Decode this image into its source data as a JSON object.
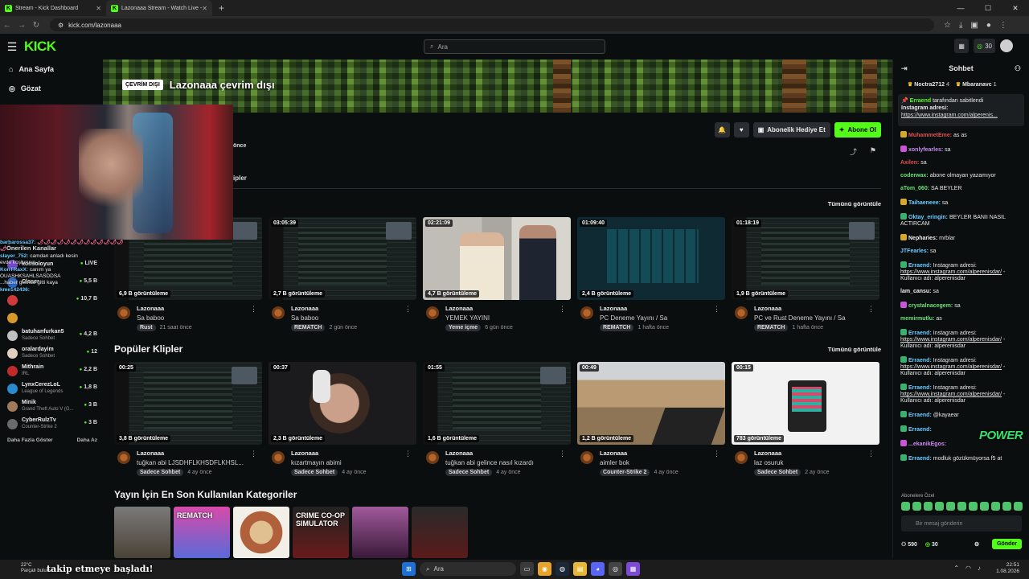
{
  "browser": {
    "tabs": [
      {
        "title": "Stream - Kick Dashboard",
        "active": false
      },
      {
        "title": "Lazonaaa Stream - Watch Live -",
        "active": true
      }
    ],
    "url": "kick.com/lazonaaa"
  },
  "topbar": {
    "logo": "KICK",
    "search_placeholder": "Ara",
    "points": "30"
  },
  "sidebar": {
    "nav": [
      {
        "label": "Ana Sayfa",
        "icon": "home-icon"
      },
      {
        "label": "Gözat",
        "icon": "compass-icon"
      }
    ],
    "suggested_title": "Önerilen Kanallar",
    "channels": [
      {
        "name": "konsoloyun",
        "category": "",
        "viewers": "LIVE",
        "color": "#7b4bd6"
      },
      {
        "name": "Closer",
        "category": "",
        "viewers": "5,5 B",
        "color": "#2d6ad0"
      },
      {
        "name": "",
        "category": "",
        "viewers": "10,7 B",
        "color": "#d03a3a"
      },
      {
        "name": "",
        "category": "",
        "viewers": "",
        "color": "#d79a2a"
      },
      {
        "name": "batuhanfurkan5",
        "category": "Sadece Sohbet",
        "viewers": "4,2 B",
        "color": "#c0c0c0"
      },
      {
        "name": "oralardayim",
        "category": "Sadece Sohbet",
        "viewers": "12",
        "color": "#e0d0c0"
      },
      {
        "name": "Mithrain",
        "category": "IRL",
        "viewers": "2,2 B",
        "color": "#c02a2a"
      },
      {
        "name": "LynxCerezLoL",
        "category": "League of Legends",
        "viewers": "1,8 B",
        "color": "#2a8ad0"
      },
      {
        "name": "Minik",
        "category": "Grand Theft Auto V (G...",
        "viewers": "3 B",
        "color": "#a07a5a"
      },
      {
        "name": "CyberRulzTv",
        "category": "Counter-Strike 2",
        "viewers": "3 B",
        "color": "#6a6a6a"
      }
    ],
    "show_more": "Daha Fazla Göster",
    "show_less": "Daha Az"
  },
  "overlay_chat": [
    {
      "user": "barbarossa37:",
      "text": "🌶🌶🌶🌶🌶🌶🌶🌶🌶🌶🌶🌶🌶🌶"
    },
    {
      "user": "slayer_752:",
      "text": "camdan anladı kesin"
    },
    {
      "user": "",
      "text": "evde koşturuyo"
    },
    {
      "user": "KonTRaxX:",
      "text": "canım ya"
    },
    {
      "user": "",
      "text": ""
    },
    {
      "user": "",
      "text": "OUASHKSAHLSASDDSA"
    },
    {
      "user": "",
      "text": "...haber gelince gitti kaya"
    },
    {
      "user": "kme142436:",
      "text": ""
    }
  ],
  "channel": {
    "offline_badge": "ÇEVRİM DIŞI",
    "offline_title": "Lazonaaa çevrim dışı",
    "gift_label": "Abonelik Hediye Et",
    "subscribe_label": "Abone Ol",
    "frag_top": "önce",
    "frag_clips": "ipler"
  },
  "sections": {
    "see_all": "Tümünü görüntüle",
    "popular_clips": "Popüler Klipler",
    "categories": "Yayın İçin En Son Kullanılan Kategoriler"
  },
  "videos": [
    {
      "duration": "",
      "views": "6,9 B görüntüleme",
      "channel": "Lazonaaa",
      "title": "Sa baboo",
      "tag": "Rust",
      "ago": "21 saat önce",
      "style": "dash"
    },
    {
      "duration": "03:05:39",
      "views": "2,7 B görüntüleme",
      "channel": "Lazonaaa",
      "title": "Sa baboo",
      "tag": "REMATCH",
      "ago": "2 gün önce",
      "style": "dash"
    },
    {
      "duration": "02:21:09",
      "views": "4,7 B görüntüleme",
      "channel": "Lazonaaa",
      "title": "YEMEK YAYINI",
      "tag": "Yeme içme",
      "ago": "6 gün önce",
      "style": "room"
    },
    {
      "duration": "01:09:40",
      "views": "2,4 B görüntüleme",
      "channel": "Lazonaaa",
      "title": "PC Deneme Yayını / Sa",
      "tag": "REMATCH",
      "ago": "1 hafta önce",
      "style": "stats"
    },
    {
      "duration": "01:18:19",
      "views": "1,9 B görüntüleme",
      "channel": "Lazonaaa",
      "title": "PC ve Rust Deneme Yayını / Sa",
      "tag": "REMATCH",
      "ago": "1 hafta önce",
      "style": "dash"
    }
  ],
  "clips": [
    {
      "duration": "00:25",
      "views": "3,8 B görüntüleme",
      "channel": "Lazonaaa",
      "title": "tuğkan abi LJSDHFLKHSDFLKHSL...",
      "tag": "Sadece Sohbet",
      "ago": "4 ay önce",
      "style": "dash"
    },
    {
      "duration": "00:37",
      "views": "2,3 B görüntüleme",
      "channel": "Lazonaaa",
      "title": "kızartmayın abimi",
      "tag": "Sadece Sohbet",
      "ago": "4 ay önce",
      "style": "face"
    },
    {
      "duration": "01:55",
      "views": "1,6 B görüntüleme",
      "channel": "Lazonaaa",
      "title": "tuğkan abi gelince nasıl kızardı",
      "tag": "Sadece Sohbet",
      "ago": "4 ay önce",
      "style": "dash"
    },
    {
      "duration": "00:49",
      "views": "1,2 B görüntüleme",
      "channel": "Lazonaaa",
      "title": "aimler bok",
      "tag": "Counter-Strike 2",
      "ago": "4 ay önce",
      "style": "cs"
    },
    {
      "duration": "00:15",
      "views": "783 görüntüleme",
      "channel": "Lazonaaa",
      "title": "laz osuruk",
      "tag": "Sadece Sohbet",
      "ago": "2 ay önce",
      "style": "white"
    }
  ],
  "categories": [
    {
      "label": "",
      "bg": "linear-gradient(180deg,#7a7a7a,#4a4236)"
    },
    {
      "label": "REMATCH",
      "bg": "linear-gradient(180deg,#d84aa8,#5a6ad8)"
    },
    {
      "label": "",
      "bg": "radial-gradient(circle,#e0c090 0 30%,#b0603a 31% 55%,#f2efe8 56%)"
    },
    {
      "label": "CRIME CO-OP SIMULATOR",
      "bg": "linear-gradient(180deg,#222,#6a1a1a)"
    },
    {
      "label": "",
      "bg": "linear-gradient(180deg,#a05a9a,#3a1a3a)"
    },
    {
      "label": "",
      "bg": "linear-gradient(180deg,#2a2a2a,#5a1a1a)"
    }
  ],
  "chat": {
    "title": "Sohbet",
    "leaderboard": [
      {
        "name": "Noctra2712",
        "count": "4"
      },
      {
        "name": "Mbaranavc",
        "count": "1"
      }
    ],
    "pinned_by": "Erraend",
    "pinned_suffix": "tarafından sabitlendi",
    "pinned_text": "Instagram adresi:",
    "pinned_link": "https://www.instagram.com/alperenis...",
    "messages": [
      {
        "user": "MuhammetEme:",
        "text": "as as",
        "color": "#e05050",
        "badge": "y"
      },
      {
        "user": "xonlyfearles:",
        "text": "sa",
        "color": "#c78cf0",
        "badge": "p"
      },
      {
        "user": "Axilen:",
        "text": "sa",
        "color": "#e05050",
        "badge": ""
      },
      {
        "user": "coderwax:",
        "text": "abone olmayan yazamıyor",
        "color": "#6fe07a",
        "badge": ""
      },
      {
        "user": "aTom_060:",
        "text": "SA BEYLER",
        "color": "#6fe07a",
        "badge": ""
      },
      {
        "user": "Taihaeneee:",
        "text": "sa",
        "color": "#6ecbff",
        "badge": "y"
      },
      {
        "user": "Oktay_eringin:",
        "text": "BEYLER BANII NASIL ACTIRCAM",
        "color": "#6ecbff",
        "badge": "g"
      },
      {
        "user": "Nepharies:",
        "text": "mrblar",
        "color": "#eee",
        "badge": "y"
      },
      {
        "user": "JTFearles:",
        "text": "sa",
        "color": "#6ecbff",
        "badge": ""
      },
      {
        "user": "Erraend:",
        "text": "Instagram adresi:",
        "link": "https://www.instagram.com/alperenisdar/",
        "tail": "- Kullanıcı adı: alperenisdar",
        "color": "#6ecbff",
        "badge": "g"
      },
      {
        "user": "lam_cansu:",
        "text": "sa",
        "color": "#eee",
        "badge": ""
      },
      {
        "user": "crystalnacegem:",
        "text": "sa",
        "color": "#6fe07a",
        "badge": "p"
      },
      {
        "user": "memirmutlu:",
        "text": "as",
        "color": "#6fe07a",
        "badge": ""
      },
      {
        "user": "Erraend:",
        "text": "Instagram adresi:",
        "link": "https://www.instagram.com/alperenisdar/",
        "tail": "- Kullanıcı adı: alperenisdar",
        "color": "#6ecbff",
        "badge": "g"
      },
      {
        "user": "Erraend:",
        "text": "Instagram adresi:",
        "link": "https://www.instagram.com/alperenisdar/",
        "tail": "- Kullanıcı adı: alperenisdar",
        "color": "#6ecbff",
        "badge": "g"
      },
      {
        "user": "Erraend:",
        "text": "Instagram adresi:",
        "link": "https://www.instagram.com/alperenisdar/",
        "tail": "- Kullanıcı adı: alperenisdar",
        "color": "#6ecbff",
        "badge": "g"
      },
      {
        "user": "Erraend:",
        "text": "@kayaear",
        "color": "#6ecbff",
        "badge": "g"
      },
      {
        "user": "Erraend:",
        "text": "",
        "color": "#6ecbff",
        "badge": "g"
      },
      {
        "user": "...ekanikEgos:",
        "text": "",
        "color": "#c78cf0",
        "badge": "p"
      },
      {
        "user": "Erraend:",
        "text": "modluk gözükmüyorsa f5 at",
        "color": "#6ecbff",
        "badge": "g"
      }
    ],
    "sub_only": "Abonelere Özel",
    "input_placeholder": "Bir mesaj gönderin",
    "followers": "590",
    "points": "30",
    "send_label": "Gönder",
    "power_text": "POWER"
  },
  "taskbar": {
    "temp": "22°C",
    "weather": "Parçalı bulutlu",
    "alert": "takip etmeye başladı!",
    "search_label": "Ara",
    "time": "22:51",
    "date": "1.08.2026"
  },
  "colors": {
    "brand_green": "#53fc18",
    "background": "#0b0e0f"
  }
}
